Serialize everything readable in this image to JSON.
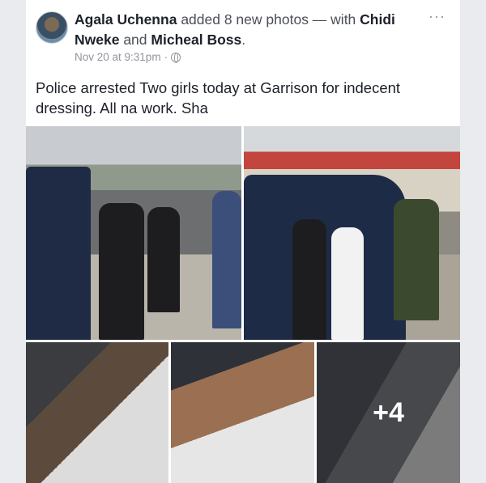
{
  "post": {
    "author": "Agala Uchenna",
    "action": "added 8 new photos — with",
    "tagged_1": "Chidi Nweke",
    "conjunction": "and",
    "tagged_2": "Micheal Boss",
    "period": ".",
    "timestamp": "Nov 20 at 9:31pm",
    "separator": "·",
    "privacy_icon": "globe-icon",
    "more_label": "···",
    "text": "Police arrested Two girls today at Garrison for indecent dressing. All na work. Sha"
  },
  "photos": {
    "more_count": "+4"
  }
}
